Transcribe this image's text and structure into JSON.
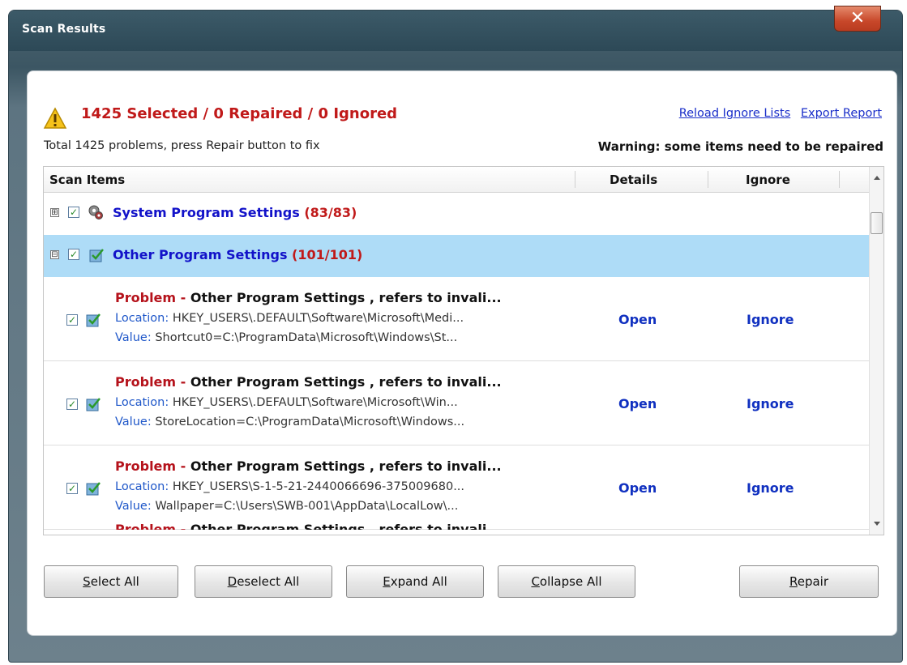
{
  "window": {
    "title": "Scan Results",
    "close_icon": "close-x-icon"
  },
  "summary": {
    "headline": "1425 Selected / 0 Repaired / 0 Ignored",
    "subtext": "Total 1425 problems, press Repair button to fix",
    "warning": "Warning: some items need to be repaired",
    "links": {
      "reload": "Reload Ignore Lists",
      "export": "Export Report"
    },
    "colors": {
      "headline": "#c01919",
      "link": "#1a2ec9"
    }
  },
  "table": {
    "columns": {
      "items": "Scan Items",
      "details": "Details",
      "ignore": "Ignore"
    },
    "groups": [
      {
        "name": "System Program Settings",
        "count": "(83/83)",
        "expander": "⊞",
        "checked": true,
        "selected": false,
        "icon": "gears-icon"
      },
      {
        "name": "Other Program Settings",
        "count": "(101/101)",
        "expander": "⊟",
        "checked": true,
        "selected": true,
        "icon": "registry-check-icon"
      }
    ],
    "rows": [
      {
        "problem_prefix": "Problem",
        "problem_sep": " - ",
        "problem_text": "Other Program Settings , refers to invali...",
        "location_key": "Location:",
        "location_val": " HKEY_USERS\\.DEFAULT\\Software\\Microsoft\\Medi...",
        "value_key": "Value:",
        "value_val": " Shortcut0=C:\\ProgramData\\Microsoft\\Windows\\St...",
        "open": "Open",
        "ignore": "Ignore"
      },
      {
        "problem_prefix": "Problem",
        "problem_sep": " - ",
        "problem_text": "Other Program Settings , refers to invali...",
        "location_key": "Location:",
        "location_val": " HKEY_USERS\\.DEFAULT\\Software\\Microsoft\\Win...",
        "value_key": "Value:",
        "value_val": " StoreLocation=C:\\ProgramData\\Microsoft\\Windows...",
        "open": "Open",
        "ignore": "Ignore"
      },
      {
        "problem_prefix": "Problem",
        "problem_sep": " - ",
        "problem_text": "Other Program Settings , refers to invali...",
        "location_key": "Location:",
        "location_val": " HKEY_USERS\\S-1-5-21-2440066696-375009680...",
        "value_key": "Value:",
        "value_val": " Wallpaper=C:\\Users\\SWB-001\\AppData\\LocalLow\\...",
        "open": "Open",
        "ignore": "Ignore"
      }
    ],
    "partial_row": {
      "problem_prefix": "Problem",
      "problem_sep": " - ",
      "problem_text": "Other Program Settings , refers to invali..."
    }
  },
  "buttons": {
    "select_all": {
      "mnemonic": "S",
      "rest": "elect All"
    },
    "deselect_all": {
      "mnemonic": "D",
      "rest": "eselect All"
    },
    "expand_all": {
      "mnemonic": "E",
      "rest": "xpand All"
    },
    "collapse_all": {
      "mnemonic": "C",
      "rest": "ollapse All"
    },
    "repair": {
      "mnemonic": "R",
      "rest": "epair"
    }
  }
}
